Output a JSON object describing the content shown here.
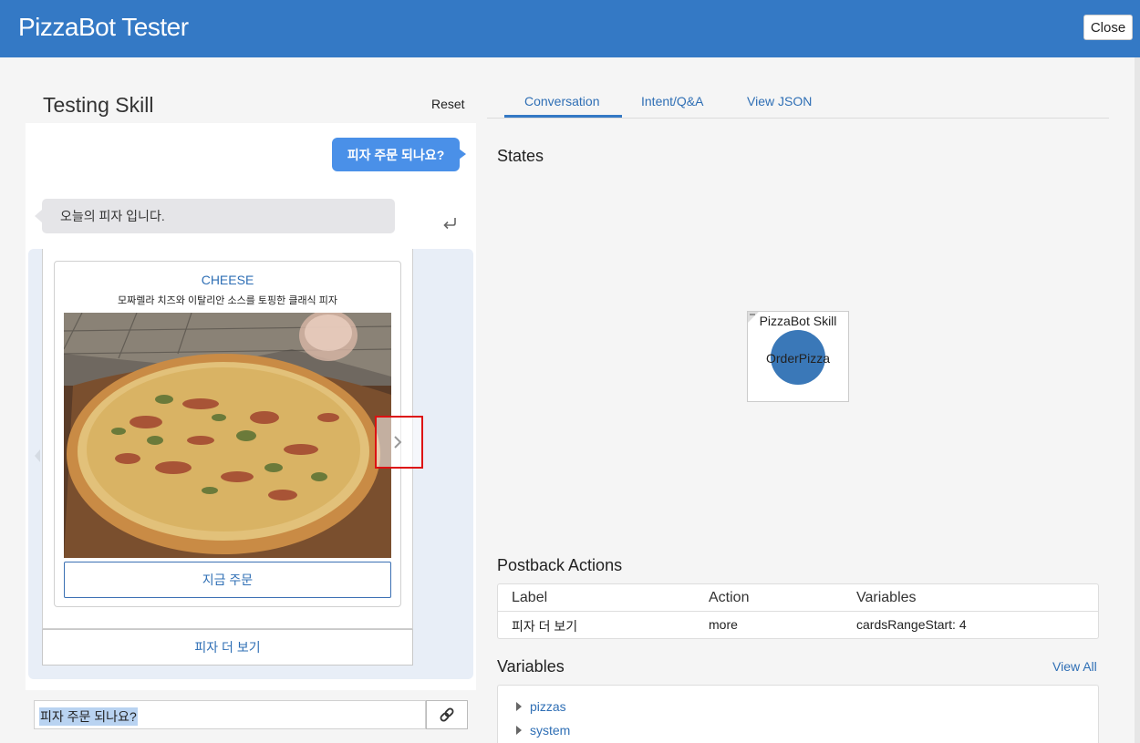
{
  "header": {
    "app_title": "PizzaBot Tester",
    "close_label": "Close",
    "bar_color": "#3479c5"
  },
  "tester": {
    "title": "Testing Skill",
    "reset_label": "Reset"
  },
  "chat": {
    "user_message": "피자 주문 되나요?",
    "bot_message": "오늘의 피자 입니다.",
    "card": {
      "title": "CHEESE",
      "description": "모짜렐라 치즈와 이탈리안 소스를 토핑한 클래식 피자",
      "image_icon": "pizza-photo",
      "button_label": "지금 주문"
    },
    "more_button_label": "피자 더 보기",
    "input_value": "피자 주문 되나요?"
  },
  "tabs": [
    {
      "label": "Conversation",
      "active": true
    },
    {
      "label": "Intent/Q&A",
      "active": false
    },
    {
      "label": "View JSON",
      "active": false
    }
  ],
  "states": {
    "heading": "States",
    "skill_name": "PizzaBot Skill",
    "current_state": "OrderPizza"
  },
  "postback": {
    "heading": "Postback Actions",
    "columns": [
      "Label",
      "Action",
      "Variables"
    ],
    "rows": [
      [
        "피자 더 보기",
        "more",
        "cardsRangeStart: 4"
      ]
    ]
  },
  "variables": {
    "heading": "Variables",
    "view_all_label": "View All",
    "items": [
      "pizzas",
      "system"
    ]
  }
}
